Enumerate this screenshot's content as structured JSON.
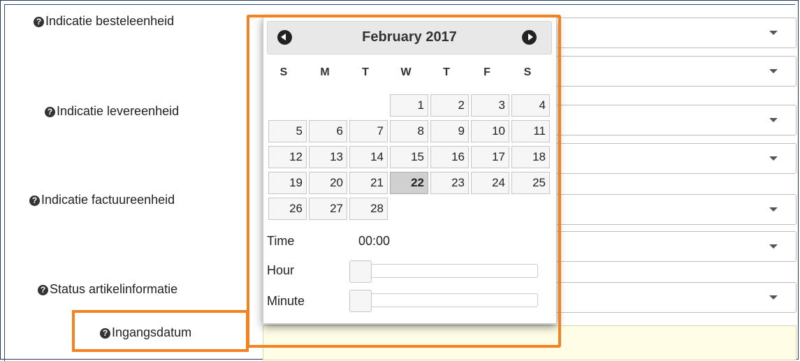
{
  "form": {
    "labels": {
      "besteleenheid": "Indicatie besteleenheid",
      "levereenheid": "Indicatie levereenheid",
      "factuureenheid": "Indicatie factuureenheid",
      "status": "Status artikelinformatie",
      "ingangsdatum": "Ingangsdatum"
    },
    "help_glyph": "?",
    "ingangsdatum_value": ""
  },
  "datepicker": {
    "title": "February 2017",
    "weekdays": [
      "S",
      "M",
      "T",
      "W",
      "T",
      "F",
      "S"
    ],
    "days": [
      "1",
      "2",
      "3",
      "4",
      "5",
      "6",
      "7",
      "8",
      "9",
      "10",
      "11",
      "12",
      "13",
      "14",
      "15",
      "16",
      "17",
      "18",
      "19",
      "20",
      "21",
      "22",
      "23",
      "24",
      "25",
      "26",
      "27",
      "28"
    ],
    "selected_day": "22",
    "time_label": "Time",
    "time_value": "00:00",
    "hour_label": "Hour",
    "minute_label": "Minute",
    "hour_value": 0,
    "minute_value": 0
  },
  "colors": {
    "highlight": "#f58220",
    "date_input_bg": "#fffde6",
    "selected_day_bg": "#d0d0d0"
  }
}
